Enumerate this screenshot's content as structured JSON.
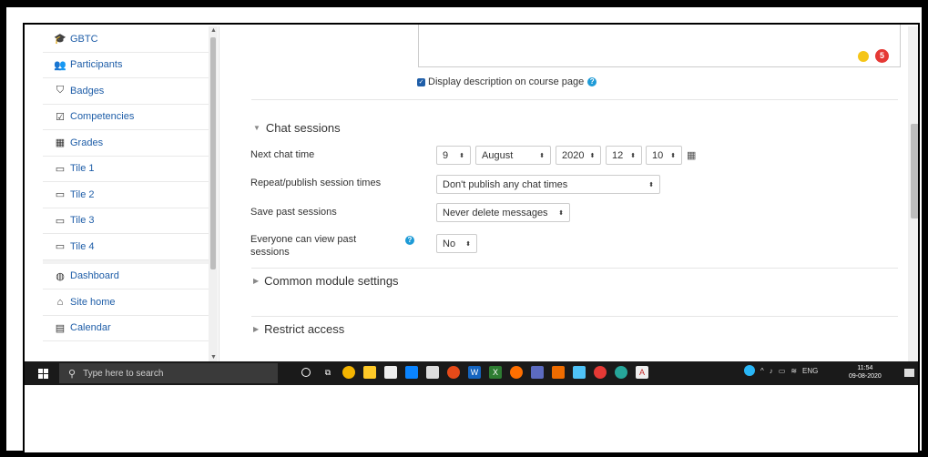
{
  "sidebar": {
    "items": [
      {
        "label": "GBTC",
        "icon": "graduation-cap-icon",
        "glyph": "🎓"
      },
      {
        "label": "Participants",
        "icon": "users-icon",
        "glyph": "👥"
      },
      {
        "label": "Badges",
        "icon": "shield-icon",
        "glyph": "⛉"
      },
      {
        "label": "Competencies",
        "icon": "check-square-icon",
        "glyph": "☑"
      },
      {
        "label": "Grades",
        "icon": "table-icon",
        "glyph": "▦"
      },
      {
        "label": "Tile 1",
        "icon": "folder-icon",
        "glyph": "▭"
      },
      {
        "label": "Tile 2",
        "icon": "folder-icon",
        "glyph": "▭"
      },
      {
        "label": "Tile 3",
        "icon": "folder-icon",
        "glyph": "▭"
      },
      {
        "label": "Tile 4",
        "icon": "folder-icon",
        "glyph": "▭"
      },
      {
        "label": "Dashboard",
        "icon": "dashboard-icon",
        "glyph": "◍"
      },
      {
        "label": "Site home",
        "icon": "home-icon",
        "glyph": "⌂"
      },
      {
        "label": "Calendar",
        "icon": "calendar-icon",
        "glyph": "▤"
      }
    ]
  },
  "form": {
    "badge_count": "5",
    "display_description_label": "Display description on course page",
    "display_description_checked": true,
    "chat_sessions_heading": "Chat sessions",
    "next_chat_time_label": "Next chat time",
    "next_chat_time": {
      "day": "9",
      "month": "August",
      "year": "2020",
      "hour": "12",
      "minute": "10"
    },
    "repeat_label": "Repeat/publish session times",
    "repeat_value": "Don't publish any chat times",
    "save_past_label": "Save past sessions",
    "save_past_value": "Never delete messages",
    "everyone_view_label": "Everyone can view past sessions",
    "everyone_view_value": "No",
    "common_module_heading": "Common module settings",
    "restrict_access_heading": "Restrict access"
  },
  "taskbar": {
    "search_placeholder": "Type here to search",
    "tray_lang": "ENG",
    "time": "11:54",
    "date": "09-08-2020",
    "accent_color": "#1a1a1a"
  }
}
